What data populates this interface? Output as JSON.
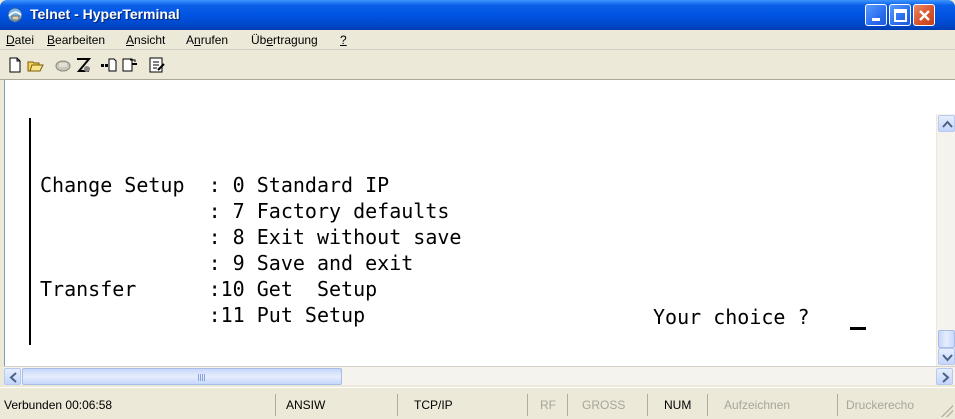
{
  "window": {
    "title": "Telnet - HyperTerminal",
    "app_icon": "hyperterminal-icon",
    "controls": [
      "minimize-icon",
      "maximize-icon",
      "close-icon"
    ]
  },
  "menu": {
    "items": [
      {
        "label": "Datei",
        "underline": "D"
      },
      {
        "label": "Bearbeiten",
        "underline": "B"
      },
      {
        "label": "Ansicht",
        "underline": "A"
      },
      {
        "label": "Anrufen",
        "underline": "n"
      },
      {
        "label": "Übertragung",
        "underline": "e"
      },
      {
        "label": "?",
        "underline": "?"
      }
    ]
  },
  "toolbar": {
    "icons": [
      "new-icon",
      "open-icon",
      "disconnect-icon",
      "connect-icon",
      "send-icon",
      "receive-icon",
      "properties-icon"
    ]
  },
  "terminal": {
    "lines": [
      "Change Setup  : 0 Standard IP",
      "              : 7 Factory defaults",
      "              : 8 Exit without save",
      "              : 9 Save and exit",
      "Transfer      :10 Get  Setup",
      "              :11 Put Setup"
    ],
    "prompt": "Your choice ? "
  },
  "statusbar": {
    "connected": "Verbunden 00:06:58",
    "emulation": "ANSIW",
    "protocol": "TCP/IP",
    "rf": "RF",
    "caps": "GROSS",
    "num": "NUM",
    "capture": "Aufzeichnen",
    "print_echo": "Druckerecho"
  },
  "colors": {
    "titlebar": "#0054e3",
    "chrome": "#ece9d8",
    "terminal_bg": "#ffffff",
    "status_dim": "#a8a69b"
  }
}
